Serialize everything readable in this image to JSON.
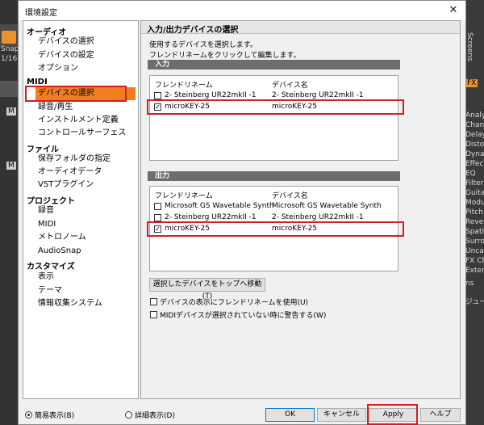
{
  "background": {
    "left_labels": [
      "Snap",
      "1/16",
      "M",
      "M"
    ],
    "right_labels": [
      "Screens",
      "FX",
      "Analyz",
      "Chann",
      "Delay",
      "Distor",
      "Dynam",
      "Effect",
      "EQ",
      "Filter",
      "Guitar",
      "Modul",
      "Pitch S",
      "Reverb",
      "Spatial",
      "Surrou",
      "Uncate",
      "FX Cha",
      "Extern",
      "ns",
      "ジュール"
    ]
  },
  "dialog": {
    "title": "環境設定",
    "close_label": "✕"
  },
  "nav": [
    {
      "category": "オーディオ",
      "items": [
        "デバイスの選択",
        "デバイスの設定",
        "オプション"
      ]
    },
    {
      "category": "MIDI",
      "items": [
        "デバイスの選択",
        "録音/再生",
        "インストルメント定義",
        "コントロールサーフェス"
      ]
    },
    {
      "category": "ファイル",
      "items": [
        "保存フォルダの指定",
        "オーディオデータ",
        "VSTプラグイン"
      ]
    },
    {
      "category": "プロジェクト",
      "items": [
        "録音",
        "MIDI",
        "メトロノーム",
        "AudioSnap"
      ]
    },
    {
      "category": "カスタマイズ",
      "items": [
        "表示",
        "テーマ",
        "情報収集システム"
      ]
    }
  ],
  "content": {
    "title": "入力/出力デバイスの選択",
    "desc1": "使用するデバイスを選択します。",
    "desc2": "フレンドリネームをクリックして編集します。",
    "input": {
      "header": "入力",
      "col_friendly": "フレンドリネーム",
      "col_device": "デバイス名",
      "rows": [
        {
          "friendly": "2- Steinberg UR22mkII -1",
          "device": "2- Steinberg UR22mkII -1",
          "checked": false
        },
        {
          "friendly": "microKEY-25",
          "device": "microKEY-25",
          "checked": true
        }
      ]
    },
    "output": {
      "header": "出力",
      "col_friendly": "フレンドリネーム",
      "col_device": "デバイス名",
      "rows": [
        {
          "friendly": "Microsoft GS Wavetable Synth",
          "device": "Microsoft GS Wavetable Synth",
          "checked": false
        },
        {
          "friendly": "2- Steinberg UR22mkII -1",
          "device": "2- Steinberg UR22mkII -1",
          "checked": false
        },
        {
          "friendly": "microKEY-25",
          "device": "microKEY-25",
          "checked": true
        }
      ]
    },
    "move_top_label": "選択したデバイスをトップへ移動(T)",
    "opt_friendly_label": "デバイスの表示にフレンドリネームを使用(U)",
    "opt_warn_label": "MIDIデバイスが選択されていない時に警告する(W)"
  },
  "footer": {
    "simple_label": "簡易表示(B)",
    "detail_label": "詳細表示(D)",
    "ok_label": "OK",
    "cancel_label": "キャンセル",
    "apply_label": "Apply",
    "help_label": "ヘルプ"
  },
  "colors": {
    "accent": "#f07e1e",
    "highlight": "#d21e23",
    "section_header": "#6d6d6d"
  },
  "check_mark": "✓"
}
